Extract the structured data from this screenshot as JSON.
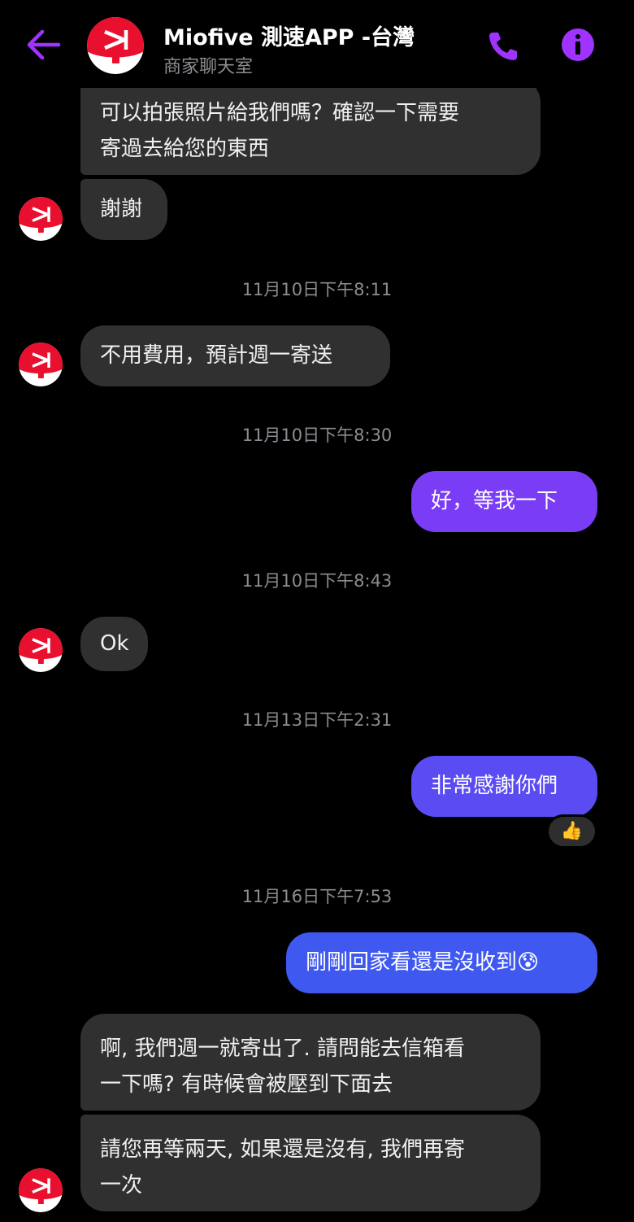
{
  "header": {
    "title": "Miofive 測速APP -台灣",
    "subtitle": "商家聊天室",
    "back_icon": "arrow-left-icon",
    "call_icon": "phone-icon",
    "info_icon": "info-icon",
    "accent_color": "#a033ff"
  },
  "messages": {
    "m1": {
      "line1": "可以拍張照片給我們嗎？確認一下需要",
      "line2": "寄過去給您的東西"
    },
    "m2": "謝謝",
    "t1": "11月10日下午8:11",
    "m3": "不用費用，預計週一寄送",
    "t2": "11月10日下午8:30",
    "m4": "好，等我一下",
    "t3": "11月10日下午8:43",
    "m5": "Ok",
    "t4": "11月13日下午2:31",
    "m6": "非常感謝你們",
    "m6_reaction": "👍",
    "t5": "11月16日下午7:53",
    "m7": "剛剛回家看還是沒收到😰",
    "m8": {
      "line1": "啊, 我們週一就寄出了. 請問能去信箱看",
      "line2": "一下嗎? 有時候會被壓到下面去"
    },
    "m9": {
      "line1": "請您再等兩天, 如果還是沒有, 我們再寄",
      "line2": "一次"
    }
  },
  "colors": {
    "incoming_bubble": "#303030",
    "outgoing_purple": "#7b3cf5",
    "outgoing_blue": "#3f59f0",
    "brand_red": "#e8102e"
  }
}
